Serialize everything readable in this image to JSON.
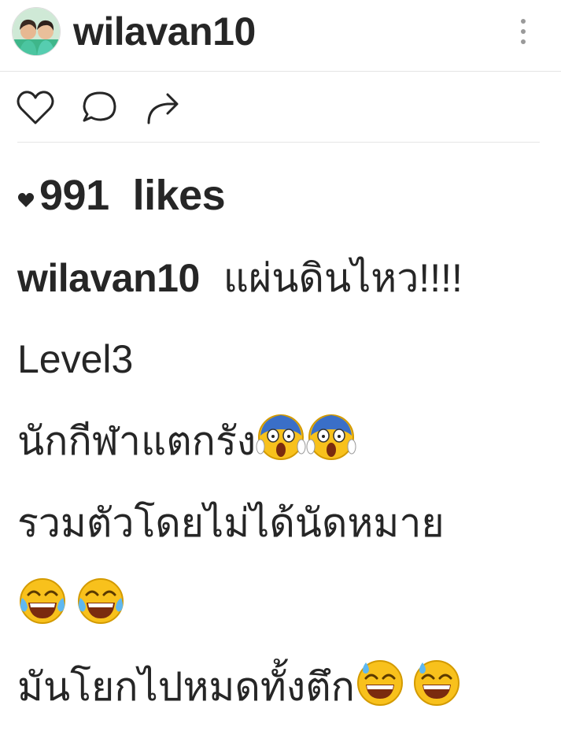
{
  "post": {
    "username": "wilavan10",
    "likes_count": "991",
    "likes_label": "likes"
  },
  "caption": {
    "author": "wilavan10",
    "line1": "แผ่นดินไหว!!!!",
    "line2": "Level3",
    "line3": "นักกีฬาแตกรัง",
    "line4": "รวมตัวโดยไม่ได้นัดหมาย",
    "line6": "มันโยกไปหมดทั้งตึก"
  },
  "icons": {
    "avatar": "profile-photo",
    "more": "vertical-dots-icon",
    "like": "heart-outline-icon",
    "comment": "speech-bubble-icon",
    "share": "share-arrow-icon",
    "likes_marker": "heart-filled-icon",
    "emoji_scream": "face-screaming-in-fear",
    "emoji_laugh": "face-with-tears-of-joy",
    "emoji_sweat": "grinning-face-with-sweat"
  },
  "colors": {
    "text": "#262626",
    "icon": "#262626",
    "divider": "#e5e5e5",
    "emoji_yellow": "#f8c11c",
    "tear_blue": "#5fb8f0",
    "fear_blue": "#3a6fc8"
  }
}
